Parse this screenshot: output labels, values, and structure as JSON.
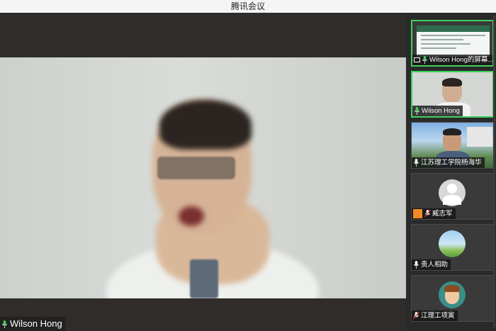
{
  "app": {
    "title": "腾讯会议"
  },
  "main_video": {
    "speaker_name": "Wilson Hong"
  },
  "sidebar": {
    "tiles": [
      {
        "label": "Wilson Hong的屏幕..."
      },
      {
        "label": "Wilson Hong"
      },
      {
        "label": "江苏理工学院杨海华"
      },
      {
        "label": "臧志军"
      },
      {
        "label": "责人相助"
      },
      {
        "label": "江理工项寅"
      }
    ]
  },
  "colors": {
    "active_border": "#3fd05a",
    "mic_green": "#3fd05a"
  }
}
